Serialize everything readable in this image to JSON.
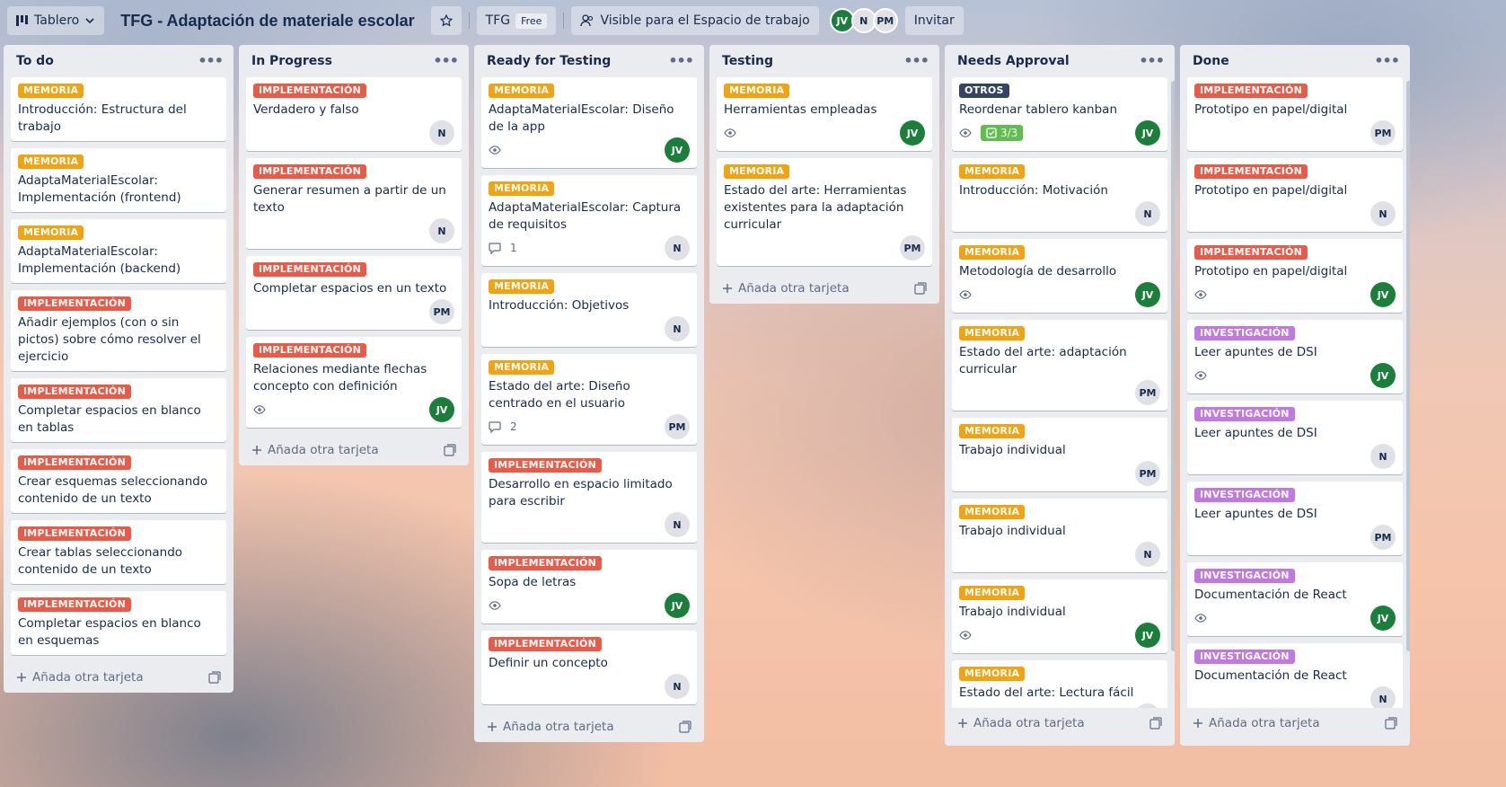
{
  "header": {
    "view_label": "Tablero",
    "board_title": "TFG - Adaptación de materiale escolar",
    "workspace": "TFG",
    "workspace_plan": "Free",
    "visibility": "Visible para el Espacio de trabajo",
    "members": [
      "JV",
      "N",
      "PM"
    ],
    "invite_label": "Invitar"
  },
  "add_card_label": "Añada otra tarjeta",
  "colors": {
    "memoria": "#f2a30f",
    "implementacion": "#eb5a46",
    "investigacion": "#c377e0",
    "otros": "#344563",
    "avatar_jv": "#1b7f3b"
  },
  "lists": [
    {
      "title": "To do",
      "cards": [
        {
          "label": "MEMORIA",
          "title": "Introducción: Estructura del trabajo"
        },
        {
          "label": "MEMORIA",
          "title": "AdaptaMaterialEscolar: Implementación (frontend)"
        },
        {
          "label": "MEMORIA",
          "title": "AdaptaMaterialEscolar: Implementación (backend)"
        },
        {
          "label": "IMPLEMENTACIÓN",
          "title": "Añadir ejemplos (con o sin pictos) sobre cómo resolver el ejercicio"
        },
        {
          "label": "IMPLEMENTACIÓN",
          "title": "Completar espacios en blanco en tablas"
        },
        {
          "label": "IMPLEMENTACIÓN",
          "title": "Crear esquemas seleccionando contenido de un texto"
        },
        {
          "label": "IMPLEMENTACIÓN",
          "title": "Crear tablas seleccionando contenido de un texto"
        },
        {
          "label": "IMPLEMENTACIÓN",
          "title": "Completar espacios en blanco en esquemas"
        }
      ]
    },
    {
      "title": "In Progress",
      "cards": [
        {
          "label": "IMPLEMENTACIÓN",
          "title": "Verdadero y falso",
          "member": "N"
        },
        {
          "label": "IMPLEMENTACIÓN",
          "title": "Generar resumen a partir de un texto",
          "member": "N"
        },
        {
          "label": "IMPLEMENTACIÓN",
          "title": "Completar espacios en un texto",
          "member": "PM"
        },
        {
          "label": "IMPLEMENTACIÓN",
          "title": "Relaciones mediante flechas concepto con definición",
          "member": "JV",
          "watch": true
        }
      ]
    },
    {
      "title": "Ready for Testing",
      "cards": [
        {
          "label": "MEMORIA",
          "title": "AdaptaMaterialEscolar: Diseño de la app",
          "member": "JV",
          "watch": true
        },
        {
          "label": "MEMORIA",
          "title": "AdaptaMaterialEscolar: Captura de requisitos",
          "member": "N",
          "comments": "1"
        },
        {
          "label": "MEMORIA",
          "title": "Introducción: Objetivos",
          "member": "N"
        },
        {
          "label": "MEMORIA",
          "title": "Estado del arte: Diseño centrado en el usuario",
          "member": "PM",
          "comments": "2"
        },
        {
          "label": "IMPLEMENTACIÓN",
          "title": "Desarrollo en espacio limitado para escribir",
          "member": "N"
        },
        {
          "label": "IMPLEMENTACIÓN",
          "title": "Sopa de letras",
          "member": "JV",
          "watch": true
        },
        {
          "label": "IMPLEMENTACIÓN",
          "title": "Definir un concepto",
          "member": "N"
        }
      ]
    },
    {
      "title": "Testing",
      "cards": [
        {
          "label": "MEMORIA",
          "title": "Herramientas empleadas",
          "member": "JV",
          "watch": true
        },
        {
          "label": "MEMORIA",
          "title": "Estado del arte: Herramientas existentes para la adaptación curricular",
          "member": "PM"
        }
      ]
    },
    {
      "title": "Needs Approval",
      "cards": [
        {
          "label": "OTROS",
          "title": "Reordenar tablero kanban",
          "member": "JV",
          "watch": true,
          "checklist": "3/3"
        },
        {
          "label": "MEMORIA",
          "title": "Introducción: Motivación",
          "member": "N"
        },
        {
          "label": "MEMORIA",
          "title": "Metodología de desarrollo",
          "member": "JV",
          "watch": true
        },
        {
          "label": "MEMORIA",
          "title": "Estado del arte: adaptación curricular",
          "member": "PM"
        },
        {
          "label": "MEMORIA",
          "title": "Trabajo individual",
          "member": "PM"
        },
        {
          "label": "MEMORIA",
          "title": "Trabajo individual",
          "member": "N"
        },
        {
          "label": "MEMORIA",
          "title": "Trabajo individual",
          "member": "JV",
          "watch": true
        },
        {
          "label": "MEMORIA",
          "title": "Estado del arte: Lectura fácil",
          "member": "PM"
        }
      ]
    },
    {
      "title": "Done",
      "cards": [
        {
          "label": "IMPLEMENTACIÓN",
          "title": "Prototipo en papel/digital",
          "member": "PM"
        },
        {
          "label": "IMPLEMENTACIÓN",
          "title": "Prototipo en papel/digital",
          "member": "N"
        },
        {
          "label": "IMPLEMENTACIÓN",
          "title": "Prototipo en papel/digital",
          "member": "JV",
          "watch": true
        },
        {
          "label": "INVESTIGACIÓN",
          "title": "Leer apuntes de DSI",
          "member": "JV",
          "watch": true
        },
        {
          "label": "INVESTIGACIÓN",
          "title": "Leer apuntes de DSI",
          "member": "N"
        },
        {
          "label": "INVESTIGACIÓN",
          "title": "Leer apuntes de DSI",
          "member": "PM"
        },
        {
          "label": "INVESTIGACIÓN",
          "title": "Documentación de React",
          "member": "JV",
          "watch": true
        },
        {
          "label": "INVESTIGACIÓN",
          "title": "Documentación de React",
          "member": "N"
        }
      ]
    }
  ]
}
